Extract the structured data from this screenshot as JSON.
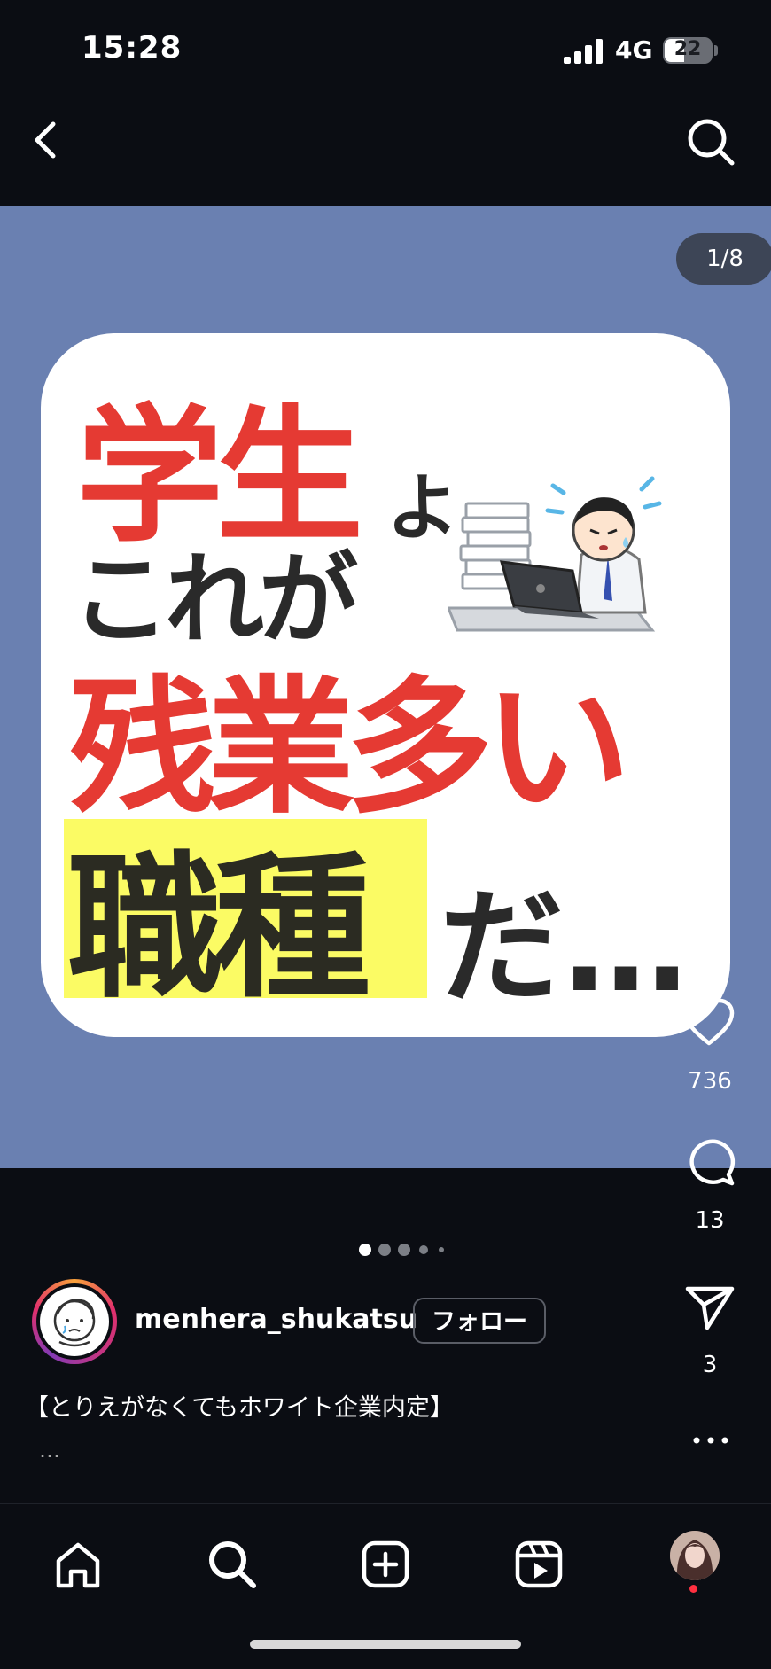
{
  "status_bar": {
    "time": "15:28",
    "network": "4G",
    "battery": "22"
  },
  "post": {
    "counter": "1/8",
    "slide": {
      "line1": "学生",
      "line1b": "よ、",
      "line2": "これが",
      "line3": "残業多い",
      "line4": "職種",
      "line4b": "だ…"
    },
    "page_dots": 5,
    "active_dot": 1
  },
  "actions": {
    "likes": "736",
    "comments": "13",
    "shares": "3"
  },
  "profile": {
    "username": "menhera_shukatsu",
    "follow_label": "フォロー"
  },
  "caption": {
    "text": "【とりえがなくてもホワイト企業内定】",
    "more": "…"
  },
  "icons": {
    "back": "chevron-left-icon",
    "search": "search-icon",
    "like": "heart-icon",
    "comment": "comment-icon",
    "share": "send-icon",
    "more": "more-icon",
    "home": "home-icon",
    "create": "plus-square-icon",
    "reels": "reels-icon"
  },
  "colors": {
    "background": "#0b0d13",
    "post_bg": "#6a80b1",
    "accent_red": "#e53a33",
    "highlight": "#fbfb64"
  }
}
